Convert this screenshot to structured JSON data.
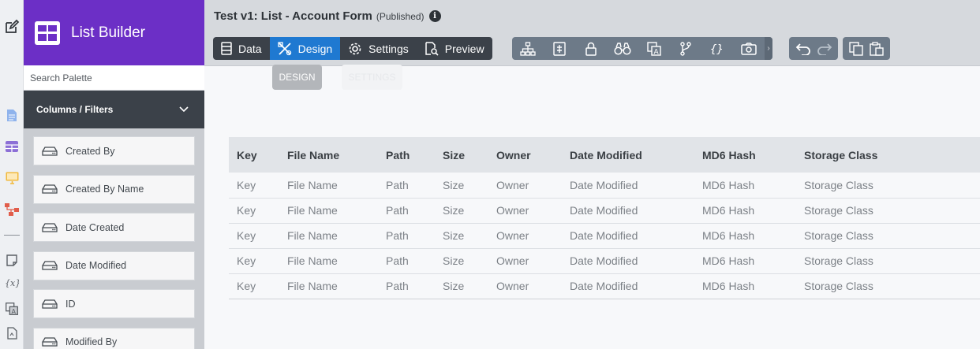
{
  "app": {
    "name": "List Builder"
  },
  "sidebar": {
    "search_placeholder": "Search Palette",
    "section_title": "Columns / Filters",
    "items": [
      "Created By",
      "Created By Name",
      "Date Created",
      "Date Modified",
      "ID",
      "Modified By"
    ]
  },
  "header": {
    "title": "Test v1: List - Account Form",
    "status": "(Published)",
    "tabs": [
      "Data",
      "Design",
      "Settings",
      "Preview"
    ],
    "active_tab": "Design"
  },
  "ghost_buttons": {
    "design": "DESIGN",
    "settings": "SETTINGS"
  },
  "table": {
    "columns": [
      "Key",
      "File Name",
      "Path",
      "Size",
      "Owner",
      "Date Modified",
      "MD6 Hash",
      "Storage Class"
    ],
    "rows": [
      [
        "Key",
        "File Name",
        "Path",
        "Size",
        "Owner",
        "Date Modified",
        "MD6 Hash",
        "Storage Class"
      ],
      [
        "Key",
        "File Name",
        "Path",
        "Size",
        "Owner",
        "Date Modified",
        "MD6 Hash",
        "Storage Class"
      ],
      [
        "Key",
        "File Name",
        "Path",
        "Size",
        "Owner",
        "Date Modified",
        "MD6 Hash",
        "Storage Class"
      ],
      [
        "Key",
        "File Name",
        "Path",
        "Size",
        "Owner",
        "Date Modified",
        "MD6 Hash",
        "Storage Class"
      ],
      [
        "Key",
        "File Name",
        "Path",
        "Size",
        "Owner",
        "Date Modified",
        "MD6 Hash",
        "Storage Class"
      ]
    ]
  },
  "toolbar_icons": [
    "hierarchy-icon",
    "form-icon",
    "lock-icon",
    "binoculars-icon",
    "translate-icon",
    "branch-icon",
    "braces-icon",
    "camera-icon"
  ],
  "rail_icons": [
    "edit-icon",
    "document-icon",
    "table-icon",
    "monitor-icon",
    "workflow-icon",
    "note-icon",
    "variable-icon",
    "translate-icon",
    "file-code-icon"
  ],
  "colors": {
    "brand": "#6c2fc6",
    "active_tab": "#1f79d1",
    "dark": "#3b4149",
    "toolbar": "#6d7a88"
  }
}
